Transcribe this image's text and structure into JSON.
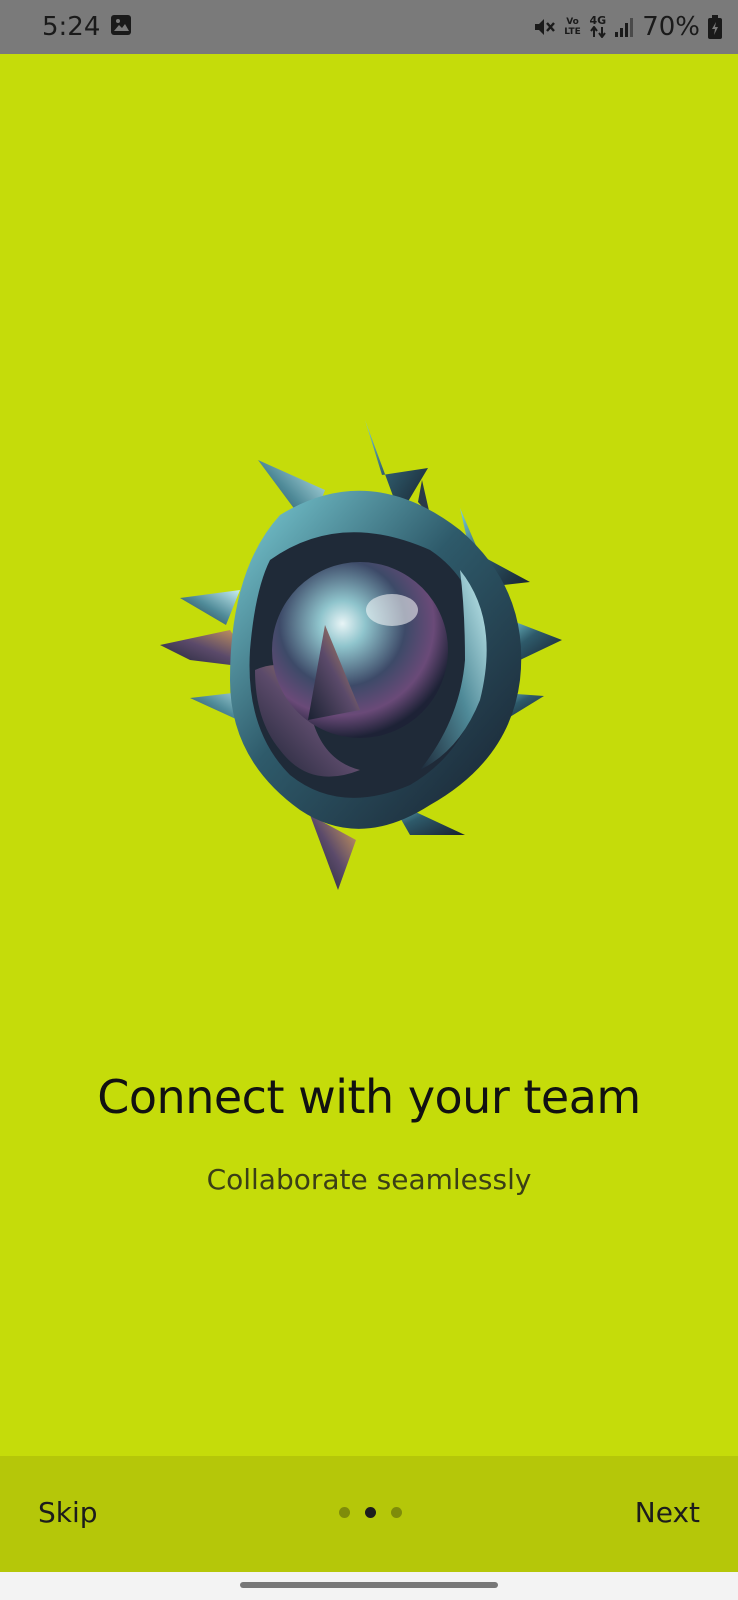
{
  "status_bar": {
    "time": "5:24",
    "battery": "70%",
    "network": "4G",
    "volte": "Vo LTE",
    "icons": [
      "gallery-icon",
      "mute-icon",
      "volte-icon",
      "network-4g-icon",
      "signal-icon",
      "battery-icon"
    ]
  },
  "onboarding": {
    "title": "Connect with your team",
    "subtitle": "Collaborate seamlessly",
    "background_color": "#c5dc0a",
    "page_count": 3,
    "active_page": 2
  },
  "bottom_nav": {
    "skip_label": "Skip",
    "next_label": "Next"
  }
}
